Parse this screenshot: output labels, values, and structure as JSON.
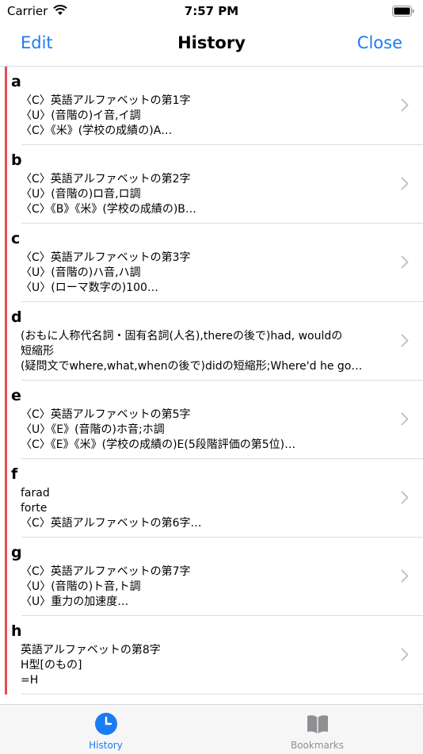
{
  "status_bar": {
    "carrier": "Carrier",
    "time": "7:57 PM",
    "wifi_icon": "wifi-icon",
    "battery_icon": "battery-icon"
  },
  "nav": {
    "left": "Edit",
    "title": "History",
    "right": "Close"
  },
  "accent_color": "#1a7cf2",
  "marker_color": "#e24d57",
  "rows": [
    {
      "head": "a",
      "lines": [
        "〈C〉英語アルファベットの第1字",
        "〈U〉(音階の)イ音,イ調",
        "〈C〉《米》(学校の成績の)A…"
      ]
    },
    {
      "head": "b",
      "lines": [
        "〈C〉英語アルファベットの第2字",
        "〈U〉(音階の)ロ音,ロ調",
        "〈C〉《B》《米》(学校の成績の)B…"
      ]
    },
    {
      "head": "c",
      "lines": [
        "〈C〉英語アルファベットの第3字",
        "〈U〉(音階の)ハ音,ハ調",
        "〈U〉(ローマ数字の)100…"
      ]
    },
    {
      "head": "d",
      "lines": [
        "(おもに人称代名詞・固有名詞(人名),thereの後で)had, wouldの",
        "短縮形",
        "(疑問文でwhere,what,whenの後で)didの短縮形;Where'd he go…"
      ]
    },
    {
      "head": "e",
      "lines": [
        "〈C〉英語アルファベットの第5字",
        "〈U〉《E》(音階の)ホ音;ホ調",
        "〈C〉《E》《米》(学校の成績の)E(5段階評価の第5位)…"
      ]
    },
    {
      "head": "f",
      "lines": [
        "farad",
        "forte",
        "〈C〉英語アルファベットの第6字…"
      ]
    },
    {
      "head": "g",
      "lines": [
        "〈C〉英語アルファベットの第7字",
        "〈U〉(音階の)ト音,ト調",
        "〈U〉重力の加速度…"
      ]
    },
    {
      "head": "h",
      "lines": [
        "英語アルファベットの第8字",
        "H型[のもの]",
        "=H"
      ]
    }
  ],
  "tabs": [
    {
      "label": "History",
      "icon": "clock-icon",
      "active": true
    },
    {
      "label": "Bookmarks",
      "icon": "book-icon",
      "active": false
    }
  ]
}
